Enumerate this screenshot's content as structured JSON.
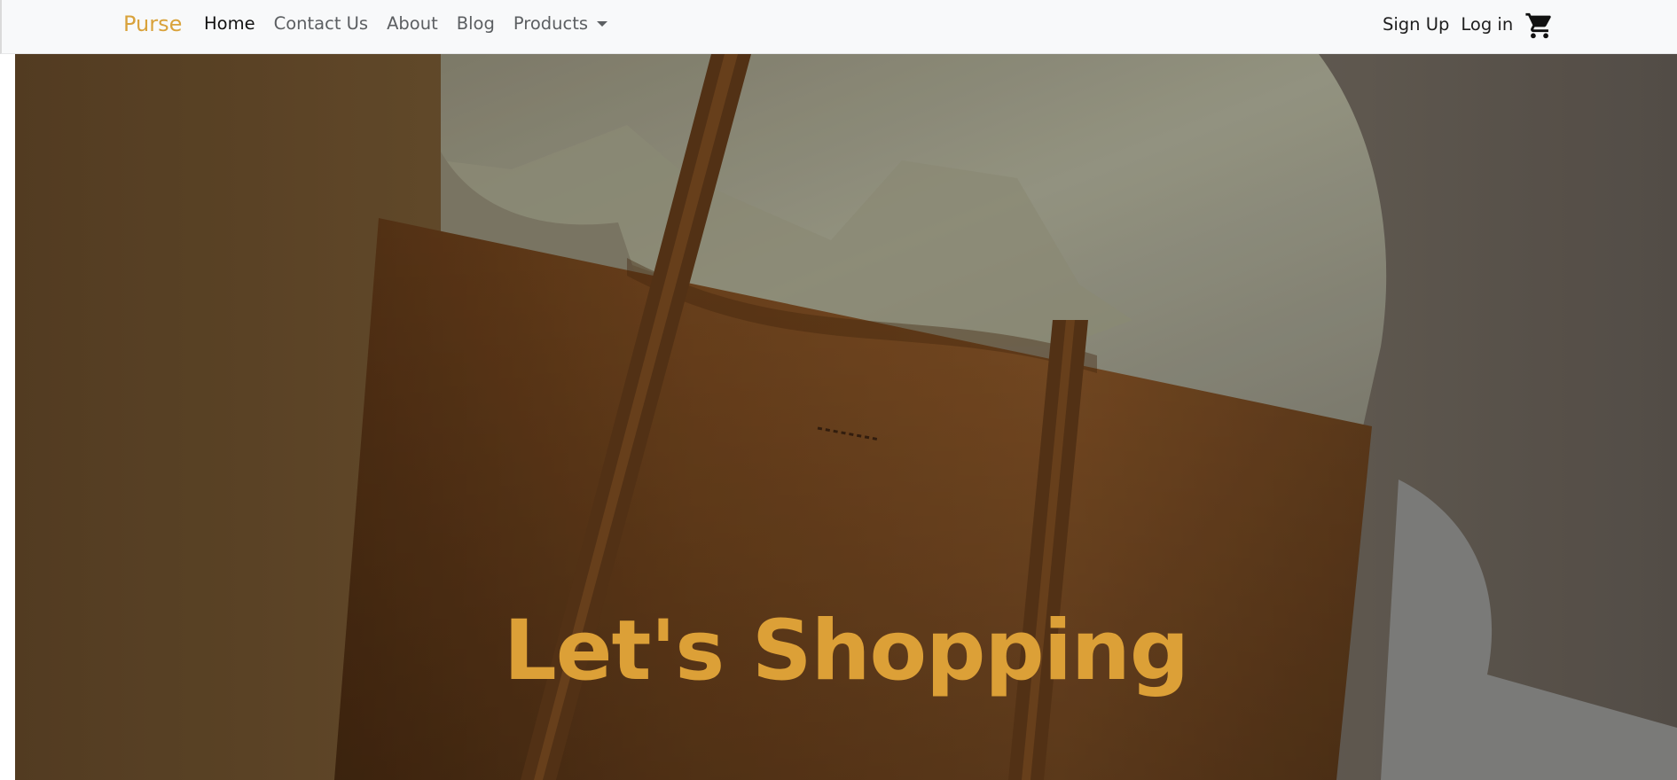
{
  "navbar": {
    "brand": "Purse",
    "links": [
      {
        "label": "Home",
        "active": true
      },
      {
        "label": "Contact Us"
      },
      {
        "label": "About"
      },
      {
        "label": "Blog"
      },
      {
        "label": "Products",
        "dropdown": true
      }
    ],
    "auth": {
      "signup": "Sign Up",
      "login": "Log in"
    },
    "cart_icon": "shopping-cart-icon"
  },
  "hero": {
    "title": "Let's Shopping",
    "image": "brown-leather-tote-bag-photo"
  },
  "colors": {
    "brand": "#d9a23b",
    "hero_title": "#dca037",
    "navbar_bg": "#f8f9fa"
  }
}
